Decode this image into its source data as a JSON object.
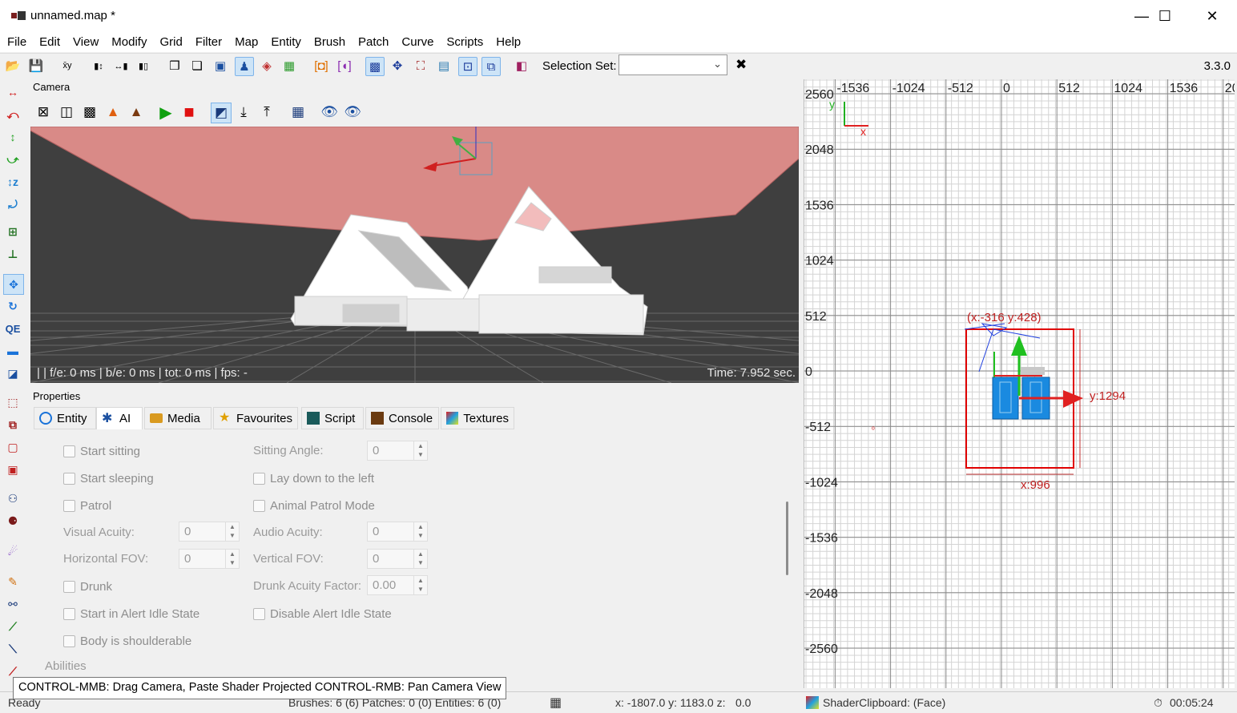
{
  "window": {
    "title": "unnamed.map *",
    "minimize": "—",
    "maximize": "☐",
    "close": "✕"
  },
  "menu": [
    "File",
    "Edit",
    "View",
    "Modify",
    "Grid",
    "Filter",
    "Map",
    "Entity",
    "Brush",
    "Patch",
    "Curve",
    "Scripts",
    "Help"
  ],
  "toolbar": {
    "selection_set_label": "Selection Set:",
    "selection_set_value": "",
    "clear_icon": "✖",
    "version": "3.3.0"
  },
  "camera": {
    "title": "Camera",
    "stats": "|  | f/e: 0 ms | b/e: 0 ms | tot: 0 ms | fps: -",
    "time": "Time: 7.952 sec."
  },
  "properties": {
    "title": "Properties",
    "tabs": [
      {
        "label": "Entity",
        "icon": "entity-icon"
      },
      {
        "label": "AI",
        "icon": "ai-icon"
      },
      {
        "label": "Media",
        "icon": "folder-icon"
      },
      {
        "label": "Favourites",
        "icon": "star-icon"
      },
      {
        "label": "Script",
        "icon": "script-icon"
      },
      {
        "label": "Console",
        "icon": "console-icon"
      },
      {
        "label": "Textures",
        "icon": "textures-icon"
      }
    ],
    "fields": {
      "start_sitting": "Start sitting",
      "sitting_angle": "Sitting Angle:",
      "sitting_angle_value": "0",
      "start_sleeping": "Start sleeping",
      "lay_down_left": "Lay down to the left",
      "patrol": "Patrol",
      "animal_patrol": "Animal Patrol Mode",
      "visual_acuity": "Visual Acuity:",
      "visual_acuity_value": "0",
      "audio_acuity": "Audio Acuity:",
      "audio_acuity_value": "0",
      "horizontal_fov": "Horizontal FOV:",
      "horizontal_fov_value": "0",
      "vertical_fov": "Vertical FOV:",
      "vertical_fov_value": "0",
      "drunk": "Drunk",
      "drunk_acuity": "Drunk Acuity Factor:",
      "drunk_acuity_value": "0.00",
      "alert_idle": "Start in Alert Idle State",
      "disable_alert_idle": "Disable Alert Idle State",
      "shoulderable": "Body is shoulderable",
      "abilities": "Abilities"
    }
  },
  "grid": {
    "x_labels": [
      "-1536",
      "-1024",
      "-512",
      "0",
      "512",
      "1024",
      "1536",
      "20"
    ],
    "y_labels": [
      "2560",
      "2048",
      "1536",
      "1024",
      "512",
      "0",
      "-512",
      "-1024",
      "-1536",
      "-2048",
      "-2560"
    ],
    "axis_x": "x",
    "axis_y": "y",
    "selection_pos": "(x:-316  y:428)",
    "selection_height": "y:1294",
    "selection_width": "x:996"
  },
  "tooltip": "CONTROL-MMB: Drag Camera, Paste Shader Projected CONTROL-RMB: Pan Camera View",
  "status": {
    "ready": "Ready",
    "counts": "Brushes: 6 (6) Patches: 0 (0) Entities: 6 (0)",
    "coords": "x: -1807.0 y: 1183.0 z:",
    "z": "0.0",
    "shader": "ShaderClipboard: (Face)",
    "elapsed": "00:05:24"
  },
  "colors": {
    "accent": "#1a73d9",
    "selection": "#e00000",
    "ceiling": "#d98a87"
  }
}
